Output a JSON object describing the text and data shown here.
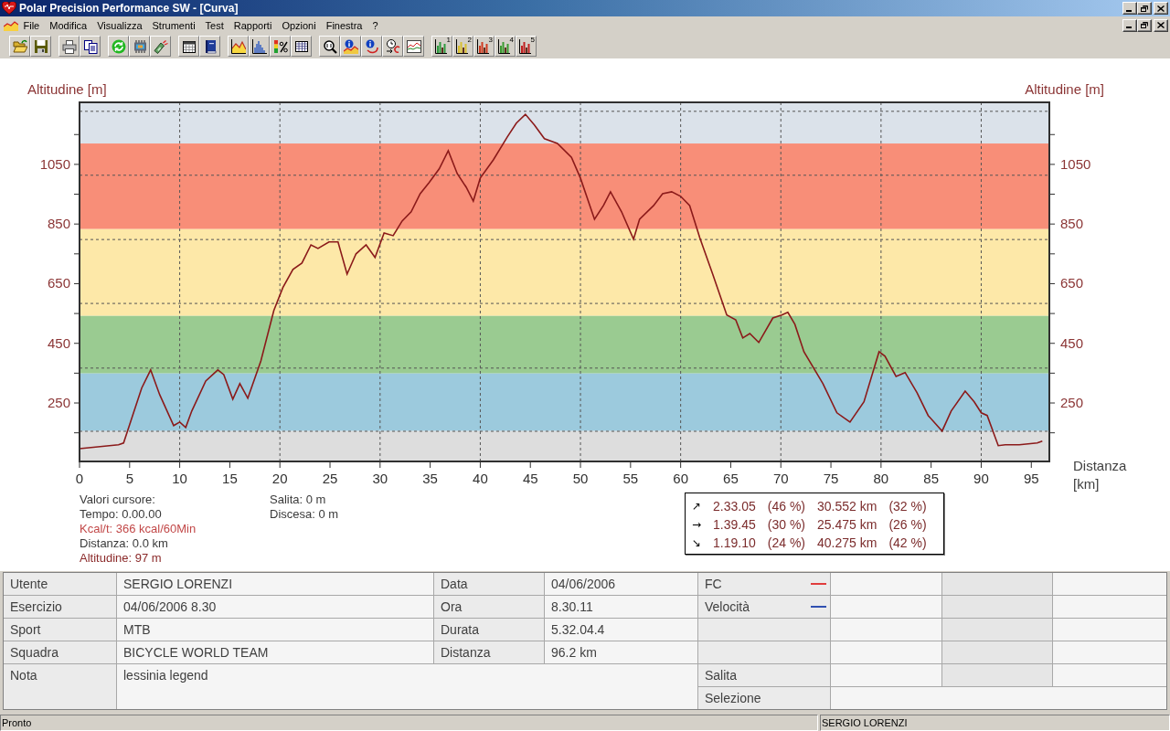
{
  "window": {
    "title": "Polar Precision Performance SW - [Curva]"
  },
  "menu": [
    {
      "label": "File"
    },
    {
      "label": "Modifica"
    },
    {
      "label": "Visualizza"
    },
    {
      "label": "Strumenti"
    },
    {
      "label": "Test"
    },
    {
      "label": "Rapporti"
    },
    {
      "label": "Opzioni"
    },
    {
      "label": "Finestra"
    },
    {
      "label": "?"
    }
  ],
  "toolbar": [
    {
      "buttons": [
        {
          "kind": "open"
        },
        {
          "kind": "save"
        }
      ]
    },
    {
      "buttons": [
        {
          "kind": "print"
        },
        {
          "kind": "copy"
        }
      ]
    },
    {
      "buttons": [
        {
          "kind": "refresh"
        },
        {
          "kind": "chip"
        },
        {
          "kind": "device"
        }
      ]
    },
    {
      "buttons": [
        {
          "kind": "calendar"
        },
        {
          "kind": "book"
        }
      ]
    },
    {
      "buttons": [
        {
          "kind": "area"
        },
        {
          "kind": "histogram"
        },
        {
          "kind": "zones"
        },
        {
          "kind": "table"
        }
      ]
    },
    {
      "buttons": [
        {
          "kind": "zoom"
        },
        {
          "kind": "info-chart"
        },
        {
          "kind": "info-loop"
        },
        {
          "kind": "clock"
        },
        {
          "kind": "compare"
        }
      ]
    },
    {
      "buttons": [
        {
          "kind": "bars",
          "number": "1",
          "color": "#2e9a3e"
        },
        {
          "kind": "bars",
          "number": "2",
          "color": "#d8c030"
        },
        {
          "kind": "bars",
          "number": "3",
          "color": "#d03a20"
        },
        {
          "kind": "bars",
          "number": "4",
          "color": "#3a9a30"
        },
        {
          "kind": "bars",
          "number": "5",
          "color": "#c02020"
        }
      ]
    }
  ],
  "chart": {
    "chart_data": {
      "type": "line",
      "xlabel": "Distanza [km]",
      "ylabel": "Altitudine [m]",
      "x": [
        0,
        3.9,
        4.4,
        5.3,
        6.2,
        7.1,
        8.0,
        9.4,
        10.0,
        10.6,
        11.2,
        12.6,
        13.8,
        14.4,
        15.3,
        16.0,
        16.8,
        18.1,
        19.4,
        20.3,
        21.3,
        22.2,
        23.1,
        23.8,
        24.9,
        25.8,
        26.7,
        27.6,
        28.6,
        29.5,
        30.4,
        31.3,
        32.2,
        33.1,
        34.0,
        34.9,
        35.9,
        36.8,
        37.7,
        38.6,
        39.3,
        40.0,
        41.3,
        42.7,
        43.6,
        44.5,
        45.4,
        46.4,
        47.7,
        49.1,
        50.0,
        51.4,
        52.3,
        53.0,
        54.1,
        55.3,
        55.9,
        57.3,
        58.2,
        59.1,
        60.0,
        60.9,
        61.9,
        63.2,
        64.6,
        65.5,
        66.2,
        66.9,
        67.8,
        69.2,
        70.1,
        70.7,
        71.4,
        72.3,
        74.2,
        75.6,
        76.9,
        78.3,
        79.8,
        80.4,
        81.5,
        82.4,
        83.6,
        84.7,
        86.1,
        87.0,
        88.4,
        89.3,
        90.0,
        90.6,
        91.7,
        92.4,
        93.8,
        95.6,
        96.1
      ],
      "series": [
        {
          "color": "#8b1a1a",
          "values": [
            97,
            110,
            116,
            208,
            300,
            361,
            278,
            174,
            186,
            168,
            223,
            324,
            361,
            345,
            263,
            315,
            266,
            391,
            560,
            637,
            698,
            719,
            780,
            768,
            790,
            790,
            682,
            750,
            780,
            738,
            820,
            811,
            860,
            891,
            952,
            989,
            1035,
            1096,
            1019,
            973,
            927,
            1004,
            1065,
            1142,
            1188,
            1218,
            1182,
            1136,
            1120,
            1074,
            1004,
            866,
            912,
            958,
            891,
            799,
            866,
            912,
            952,
            958,
            943,
            912,
            805,
            682,
            545,
            529,
            468,
            483,
            453,
            535,
            545,
            554,
            514,
            422,
            315,
            217,
            186,
            254,
            422,
            407,
            339,
            352,
            284,
            208,
            156,
            223,
            290,
            254,
            217,
            208,
            107,
            110,
            110,
            116,
            122
          ]
        }
      ],
      "xlim": [
        0,
        96.8
      ],
      "ylim": [
        54,
        1258
      ],
      "xticks": [
        0,
        5,
        10,
        15,
        20,
        25,
        30,
        35,
        40,
        45,
        50,
        55,
        60,
        65,
        70,
        75,
        80,
        85,
        90,
        95
      ],
      "yticks": [
        250,
        450,
        650,
        850,
        1050
      ],
      "grid": true,
      "bands": [
        {
          "axis": "y",
          "from": 1120,
          "to": 1258,
          "color": "#dbe2ea"
        },
        {
          "axis": "y",
          "from": 833,
          "to": 1120,
          "color": "#f88e78"
        },
        {
          "axis": "y",
          "from": 542,
          "to": 833,
          "color": "#fde8a8"
        },
        {
          "axis": "y",
          "from": 349,
          "to": 542,
          "color": "#9acb91"
        },
        {
          "axis": "y",
          "from": 156,
          "to": 349,
          "color": "#9ccadd"
        },
        {
          "axis": "y",
          "from": 54,
          "to": 156,
          "color": "#dddddd"
        }
      ]
    },
    "right_axis": {
      "label": "Altitudine [m]",
      "ticks": [
        "1050",
        "850",
        "650",
        "450",
        "250"
      ]
    }
  },
  "cursor_panel": {
    "title": "Valori cursore:",
    "items": [
      {
        "text": "Tempo: 0.00.00",
        "color": "#3a3a3a"
      },
      {
        "text": "Kcal/t: 366 kcal/60Min",
        "color": "#c24848"
      },
      {
        "text": "Distanza: 0.0 km",
        "color": "#3a3a3a"
      },
      {
        "text": "Altitudine: 97 m",
        "color": "#8b2a2a"
      }
    ],
    "climb": [
      {
        "text": "Salita: 0 m"
      },
      {
        "text": "Discesa: 0 m"
      }
    ]
  },
  "summary": [
    {
      "arrow": "↗",
      "time": "2.33.05",
      "time_share": "(46 %)",
      "distance": "30.552 km",
      "distance_share": "(32 %)"
    },
    {
      "arrow": "→",
      "time": "1.39.45",
      "time_share": "(30 %)",
      "distance": "25.475 km",
      "distance_share": "(26 %)"
    },
    {
      "arrow": "↘",
      "time": "1.19.10",
      "time_share": "(24 %)",
      "distance": "40.275 km",
      "distance_share": "(42 %)"
    }
  ],
  "info_table": {
    "fields": [
      {
        "label": "Utente",
        "value": "SERGIO LORENZI"
      },
      {
        "label": "Esercizio",
        "value": "04/06/2006 8.30"
      },
      {
        "label": "Sport",
        "value": "MTB"
      },
      {
        "label": "Squadra",
        "value": "BICYCLE WORLD TEAM"
      }
    ],
    "fields2": [
      {
        "label": "Data",
        "value": "04/06/2006"
      },
      {
        "label": "Ora",
        "value": "8.30.11"
      },
      {
        "label": "Durata",
        "value": "5.32.04.4"
      },
      {
        "label": "Distanza",
        "value": "96.2 km"
      }
    ],
    "series": [
      {
        "label": "FC",
        "color": "#e03c3c"
      },
      {
        "label": "Velocità",
        "color": "#3050b0"
      }
    ],
    "note": {
      "label": "Nota",
      "value": "lessinia legend"
    },
    "extra": [
      {
        "label": "Salita"
      },
      {
        "label": "Selezione"
      }
    ]
  },
  "status_bar": [
    {
      "text": "Pronto"
    },
    {
      "text": "SERGIO LORENZI"
    }
  ]
}
